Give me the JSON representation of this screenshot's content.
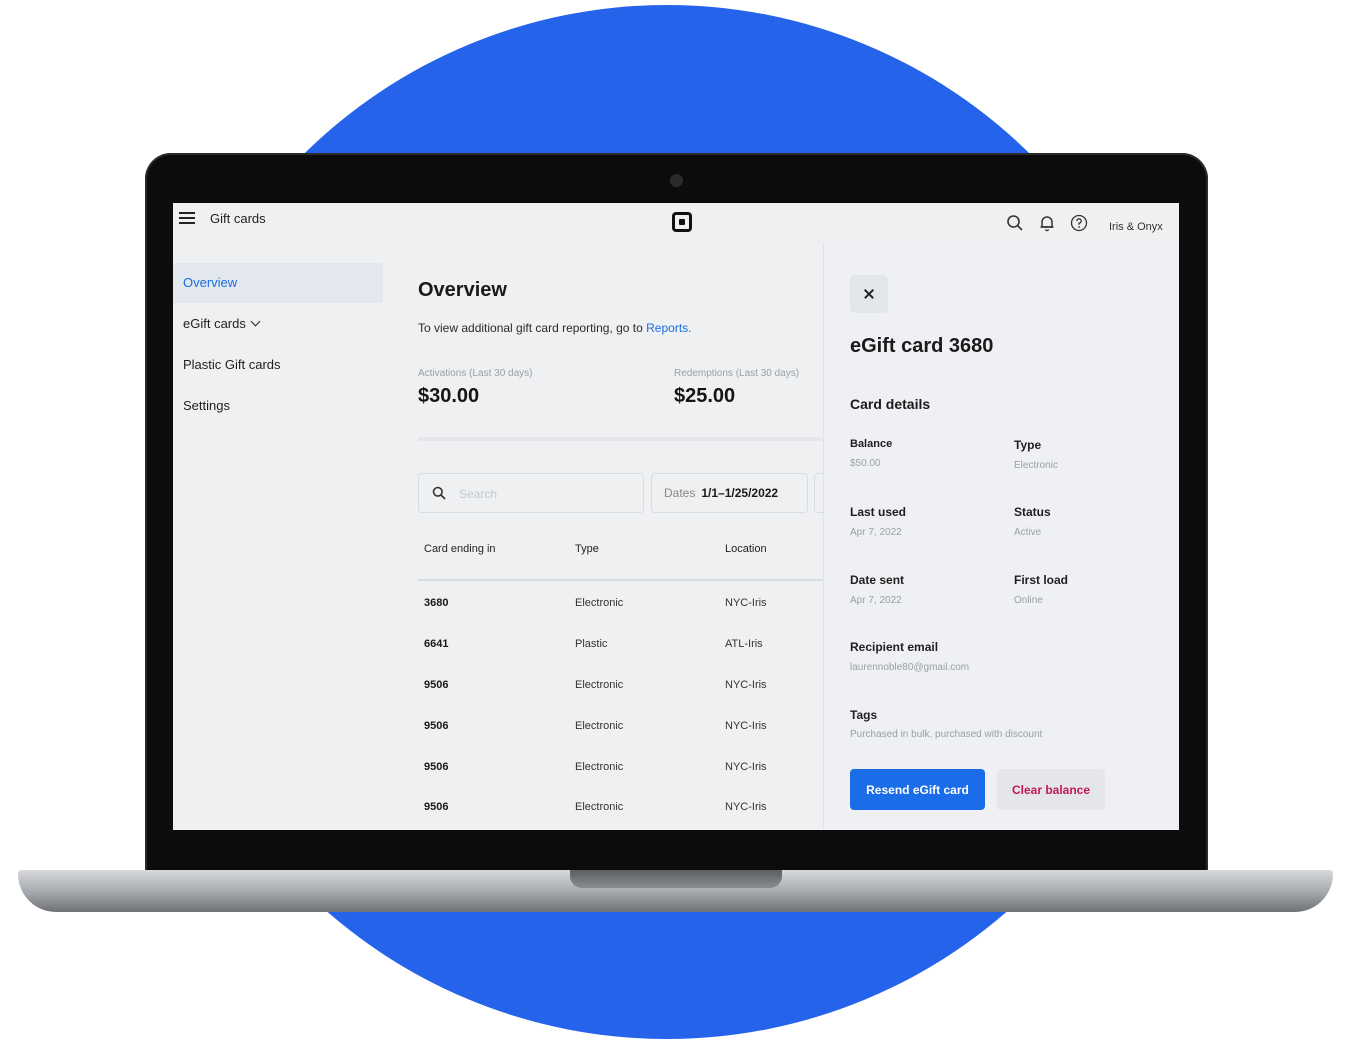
{
  "app": {
    "title": "Gift cards",
    "account": "Iris & Onyx"
  },
  "sidebar": {
    "items": [
      {
        "label": "Overview"
      },
      {
        "label": "eGift cards"
      },
      {
        "label": "Plastic Gift cards"
      },
      {
        "label": "Settings"
      }
    ]
  },
  "main": {
    "title": "Overview",
    "info_text": "To view additional gift card reporting, go to",
    "info_link": "Reports.",
    "stats": [
      {
        "label": "Activations (Last 30 days)",
        "value": "$30.00"
      },
      {
        "label": "Redemptions (Last 30 days)",
        "value": "$25.00"
      }
    ],
    "search": {
      "placeholder": "Search"
    },
    "dates": {
      "label": "Dates",
      "value": "1/1–1/25/2022"
    },
    "table": {
      "headers": [
        "Card ending in",
        "Type",
        "Location"
      ],
      "rows": [
        [
          "3680",
          "Electronic",
          "NYC-Iris"
        ],
        [
          "6641",
          "Plastic",
          "ATL-Iris"
        ],
        [
          "9506",
          "Electronic",
          "NYC-Iris"
        ],
        [
          "9506",
          "Electronic",
          "NYC-Iris"
        ],
        [
          "9506",
          "Electronic",
          "NYC-Iris"
        ],
        [
          "9506",
          "Electronic",
          "NYC-Iris"
        ]
      ]
    }
  },
  "panel": {
    "title": "eGift card 3680",
    "section": "Card details",
    "fields": {
      "balance": {
        "label": "Balance",
        "value": "$50.00"
      },
      "type": {
        "label": "Type",
        "value": "Electronic"
      },
      "last_used": {
        "label": "Last used",
        "value": "Apr 7, 2022"
      },
      "status": {
        "label": "Status",
        "value": "Active"
      },
      "date_sent": {
        "label": "Date sent",
        "value": "Apr 7, 2022"
      },
      "first_load": {
        "label": "First load",
        "value": "Online"
      },
      "recipient_email": {
        "label": "Recipient email",
        "value": "laurennoble80@gmail.com"
      },
      "tags": {
        "label": "Tags",
        "value": "Purchased in bulk, purchased with discount"
      }
    },
    "resend_label": "Resend eGift card",
    "clear_label": "Clear balance"
  },
  "colors": {
    "background_circle": "#2563eb",
    "accent": "#1a6ce8",
    "danger": "#c2185b"
  },
  "icons": [
    "menu-icon",
    "square-logo-icon",
    "search-icon",
    "bell-icon",
    "help-icon",
    "close-icon",
    "chevron-down-icon"
  ]
}
